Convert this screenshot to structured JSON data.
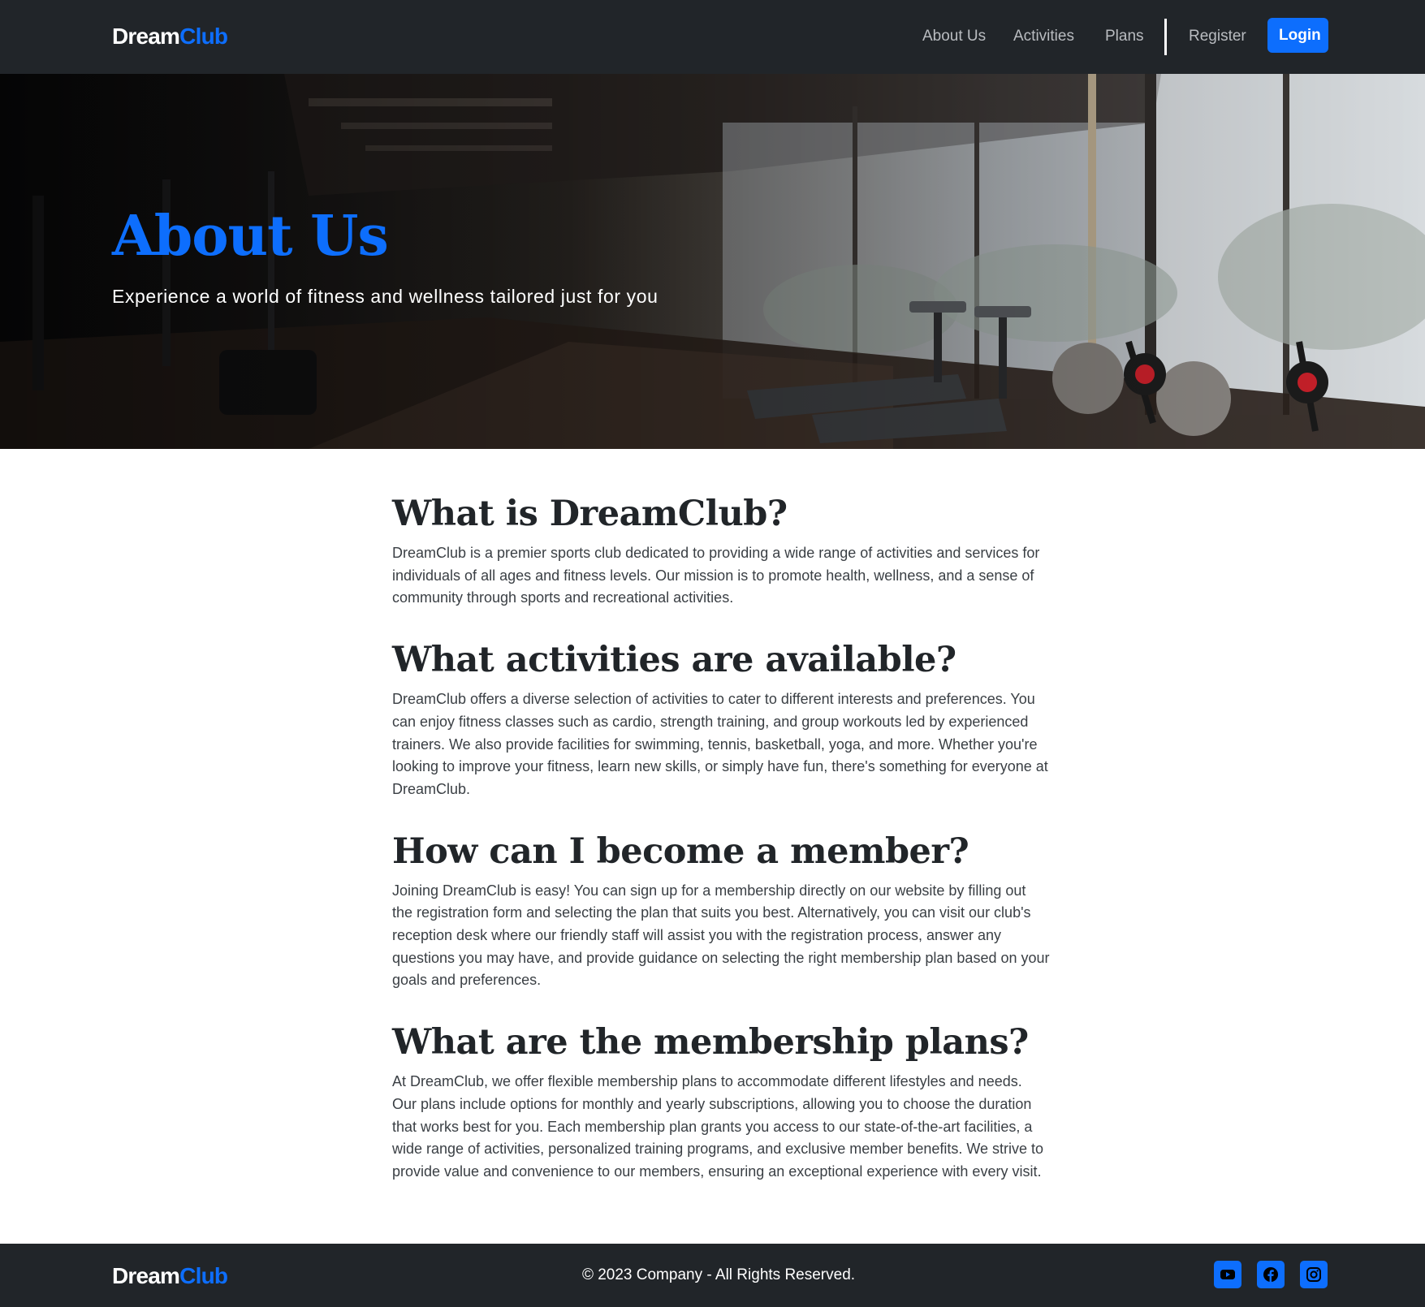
{
  "nav": {
    "brand_part1": "Dream",
    "brand_part2": "Club",
    "links": [
      "About Us",
      "Activities",
      "Plans"
    ],
    "register_label": "Register",
    "login_label": "Login"
  },
  "hero": {
    "title": "About Us",
    "subtitle": "Experience a world of fitness and wellness tailored just for you"
  },
  "sections": [
    {
      "heading": "What is DreamClub?",
      "body": "DreamClub is a premier sports club dedicated to providing a wide range of activities and services for individuals of all ages and fitness levels. Our mission is to promote health, wellness, and a sense of community through sports and recreational activities."
    },
    {
      "heading": "What activities are available?",
      "body": "DreamClub offers a diverse selection of activities to cater to different interests and preferences. You can enjoy fitness classes such as cardio, strength training, and group workouts led by experienced trainers. We also provide facilities for swimming, tennis, basketball, yoga, and more. Whether you're looking to improve your fitness, learn new skills, or simply have fun, there's something for everyone at DreamClub."
    },
    {
      "heading": "How can I become a member?",
      "body": "Joining DreamClub is easy! You can sign up for a membership directly on our website by filling out the registration form and selecting the plan that suits you best. Alternatively, you can visit our club's reception desk where our friendly staff will assist you with the registration process, answer any questions you may have, and provide guidance on selecting the right membership plan based on your goals and preferences."
    },
    {
      "heading": "What are the membership plans?",
      "body": "At DreamClub, we offer flexible membership plans to accommodate different lifestyles and needs. Our plans include options for monthly and yearly subscriptions, allowing you to choose the duration that works best for you. Each membership plan grants you access to our state-of-the-art facilities, a wide range of activities, personalized training programs, and exclusive member benefits. We strive to provide value and convenience to our members, ensuring an exceptional experience with every visit."
    }
  ],
  "footer": {
    "brand_part1": "Dream",
    "brand_part2": "Club",
    "copyright": "© 2023 Company - All Rights Reserved.",
    "social_icons": [
      "youtube-icon",
      "facebook-icon",
      "instagram-icon"
    ]
  },
  "colors": {
    "accent": "#0d6efd",
    "dark": "#212529"
  }
}
